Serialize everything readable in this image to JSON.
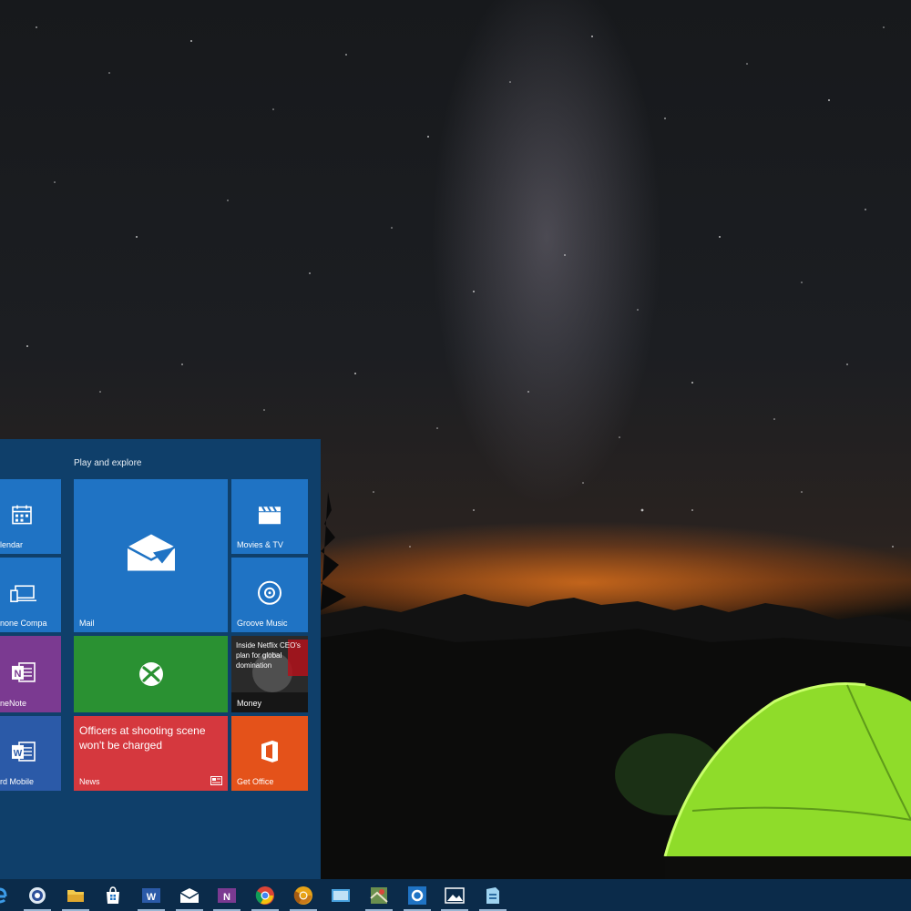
{
  "start_menu": {
    "group_label": "Play and explore",
    "tiles": {
      "calendar": "lendar",
      "phone_companion": "none Compa",
      "onenote": "neNote",
      "word_mobile": "rd Mobile",
      "mail": "Mail",
      "xbox": "",
      "news": "News",
      "news_headline": "Officers at shooting scene won't be charged",
      "movies_tv": "Movies & TV",
      "groove_music": "Groove Music",
      "money": "Money",
      "money_headline": "Inside Netflix CEO's plan for global domination",
      "get_office": "Get Office"
    }
  },
  "taskbar": {
    "icons": [
      "edge-icon",
      "cortana-icon",
      "file-explorer-icon",
      "store-icon",
      "word-icon",
      "mail-icon",
      "onenote-icon",
      "chrome-icon",
      "chrome-canary-icon",
      "photos-app-icon",
      "maps-icon",
      "outlook-icon",
      "photos-icon",
      "sway-icon"
    ]
  },
  "colors": {
    "tile_blue": "#1f73c4",
    "tile_green": "#2a9132",
    "tile_purple": "#7b3a91",
    "tile_red": "#d5383e",
    "tile_orange": "#e4521a",
    "start_bg": "#0f3f6a",
    "taskbar_bg": "#0b2b4a"
  }
}
